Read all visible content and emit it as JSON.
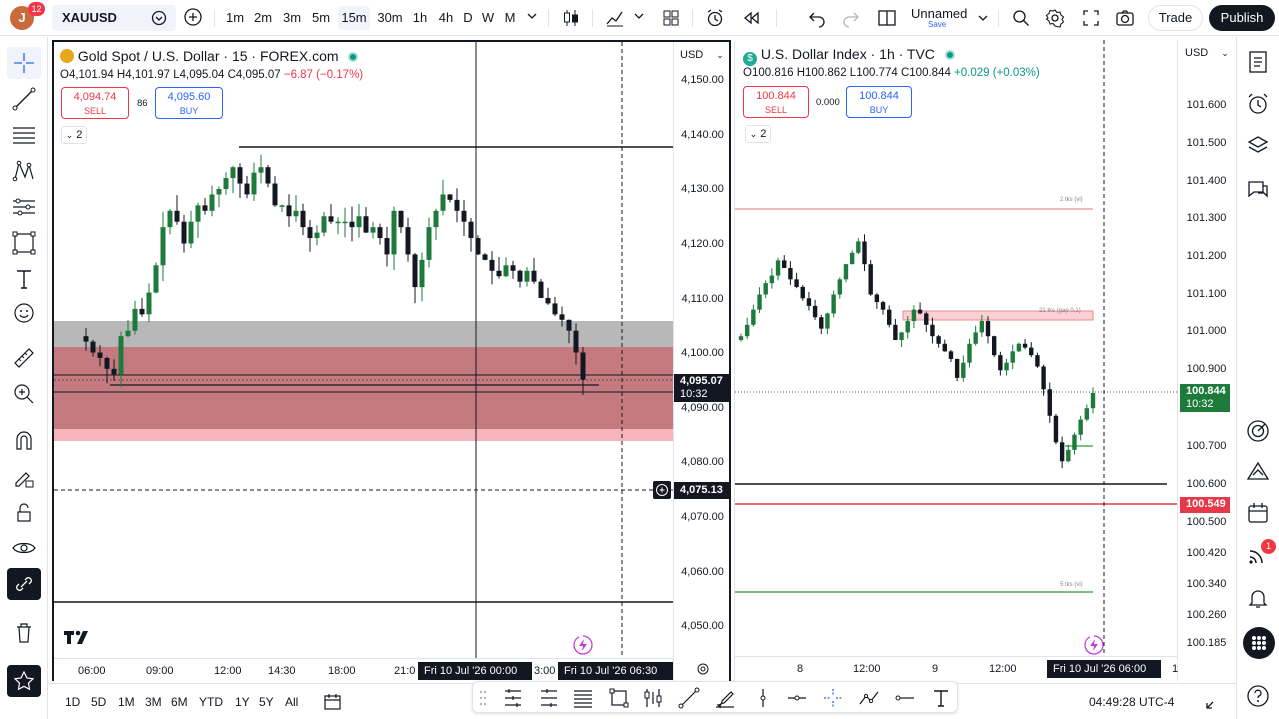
{
  "topbar": {
    "avatar_letter": "J",
    "notif_count": "12",
    "symbol": "XAUUSD",
    "intervals": [
      "1m",
      "2m",
      "3m",
      "5m",
      "15m",
      "30m",
      "1h",
      "4h",
      "D",
      "W",
      "M"
    ],
    "active_interval": "15m",
    "layout_name": "Unnamed",
    "layout_save": "Save",
    "trade_label": "Trade",
    "publish_label": "Publish"
  },
  "left_pane": {
    "title": "Gold Spot / U.S. Dollar · 15 · FOREX.com",
    "ohlc": {
      "o": "O4,101.94",
      "h": "H4,101.97",
      "l": "L4,095.04",
      "c": "C4,095.07",
      "chg": "−6.87 (−0.17%)"
    },
    "sell_price": "4,094.74",
    "sell_label": "SELL",
    "spread": "86",
    "buy_price": "4,095.60",
    "buy_label": "BUY",
    "indicator_count": "2",
    "currency": "USD",
    "y_labels": [
      "4,150.00",
      "4,140.00",
      "4,130.00",
      "4,120.00",
      "4,110.00",
      "4,100.00",
      "4,090.00",
      "4,080.00",
      "4,070.00",
      "4,060.00",
      "4,050.00"
    ],
    "current_price": "4,095.07",
    "current_timer": "10:32",
    "crosshair_price": "4,075.13",
    "x_labels": [
      "06:00",
      "09:00",
      "12:00",
      "14:30",
      "18:00",
      "21:0"
    ],
    "x_chip_1": "Fri 10 Jul '26   00:00",
    "x_chip_1_tail": "3:00",
    "x_chip_2": "Fri 10 Jul '26   06:30"
  },
  "right_pane": {
    "title": "U.S. Dollar Index · 1h · TVC",
    "ohlc": {
      "o": "O100.816",
      "h": "H100.862",
      "l": "L100.774",
      "c": "C100.844",
      "chg": "+0.029 (+0.03%)"
    },
    "sell_price": "100.844",
    "sell_label": "SELL",
    "spread": "0.000",
    "buy_price": "100.844",
    "buy_label": "BUY",
    "indicator_count": "2",
    "currency": "USD",
    "y_labels": [
      "101.600",
      "101.500",
      "101.400",
      "101.300",
      "101.200",
      "101.100",
      "101.000",
      "100.900",
      "100.700",
      "100.600",
      "100.500",
      "100.420",
      "100.340",
      "100.260",
      "100.185"
    ],
    "current_price": "100.844",
    "current_timer": "10:32",
    "red_line_price": "100.549",
    "annot_top": "2 tks (vi)",
    "annot_mid": "21 tks (gap 0.1)",
    "annot_low": "5 tks (vi)",
    "x_labels": [
      "8",
      "12:00",
      "9",
      "12:00"
    ],
    "x_chip": "Fri 10 Jul '26   06:00",
    "x_tail": "1"
  },
  "bottombar": {
    "ranges": [
      "1D",
      "5D",
      "1M",
      "3M",
      "6M",
      "YTD",
      "1Y",
      "5Y",
      "All"
    ],
    "clock": "04:49:28 UTC-4"
  },
  "rightbar": {
    "badge": "1"
  },
  "colors": {
    "up": "#131722",
    "green": "#1e7a3a",
    "red_zone": "#c57a80",
    "grey_zone": "#b8b8b8",
    "pink_zone": "#f7b5bb",
    "accent": "#2962ff"
  }
}
